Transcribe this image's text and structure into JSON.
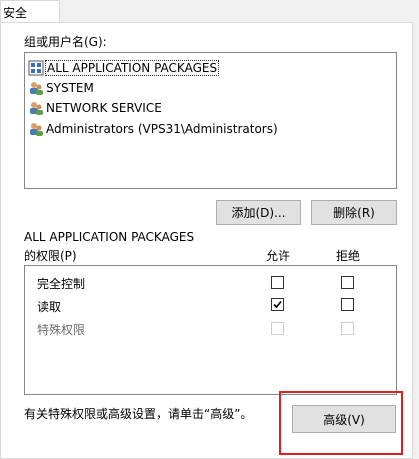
{
  "tabs": [
    "安全"
  ],
  "group_label": "组或用户名(G):",
  "principals": [
    {
      "name": "ALL APPLICATION PACKAGES",
      "icon": "app-packages-icon"
    },
    {
      "name": "SYSTEM",
      "icon": "users-icon"
    },
    {
      "name": "NETWORK SERVICE",
      "icon": "users-icon"
    },
    {
      "name": "Administrators (VPS31\\Administrators)",
      "icon": "users-icon"
    }
  ],
  "buttons": {
    "add": "添加(D)...",
    "remove": "删除(R)",
    "advanced": "高级(V)"
  },
  "perm_header": {
    "line1": "ALL APPLICATION PACKAGES",
    "line2": "的权限(P)",
    "allow": "允许",
    "deny": "拒绝"
  },
  "permissions": [
    {
      "name": "完全控制",
      "allow": false,
      "deny": false,
      "disabled": false
    },
    {
      "name": "读取",
      "allow": true,
      "deny": false,
      "disabled": false
    },
    {
      "name": "特殊权限",
      "allow": false,
      "deny": false,
      "disabled": true
    }
  ],
  "footer_text": "有关特殊权限或高级设置，请单击“高级”。",
  "colors": {
    "highlight": "#e02020",
    "button_bg": "#e1e1e1",
    "selected_row": "#cce8ff"
  }
}
